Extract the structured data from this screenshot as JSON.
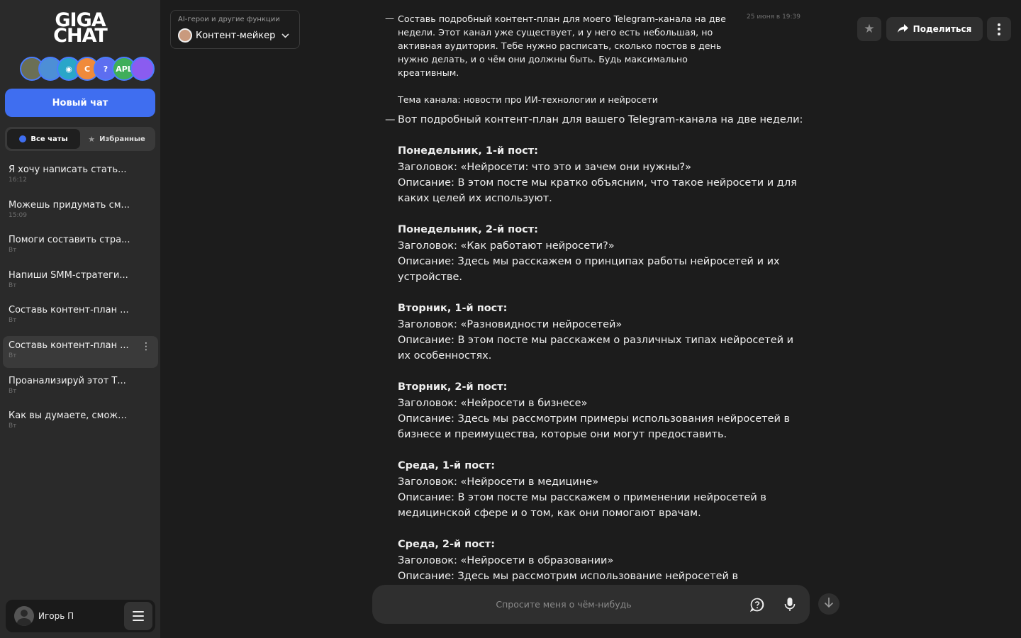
{
  "brand": {
    "line1": "GIGA",
    "line2": "CHAT"
  },
  "hero_avatars": [
    {
      "icon": "cat-avatar",
      "glyph": "",
      "bg": "#6b6f55"
    },
    {
      "icon": "rocket-avatar",
      "glyph": "",
      "bg": "#4d8fd6"
    },
    {
      "icon": "robot-avatar",
      "glyph": "◉",
      "bg": "#2aa6c9"
    },
    {
      "icon": "swirl-avatar",
      "glyph": "C",
      "bg": "#f08a3a"
    },
    {
      "icon": "question-avatar",
      "glyph": "?",
      "bg": "#5d6ef0"
    },
    {
      "icon": "apl-avatar",
      "glyph": "APL",
      "bg": "#3fae5a"
    },
    {
      "icon": "text-avatar",
      "glyph": "",
      "bg": "#8a5cf0"
    }
  ],
  "sidebar": {
    "new_chat": "Новый чат",
    "tabs": {
      "all": "Все чаты",
      "favorites": "Избранные"
    },
    "chats": [
      {
        "title": "Я хочу написать стать...",
        "time": "16:12"
      },
      {
        "title": "Можешь придумать см...",
        "time": "15:09"
      },
      {
        "title": "Помоги составить стра...",
        "time": "Вт"
      },
      {
        "title": "Напиши SMM-стратеги...",
        "time": "Вт"
      },
      {
        "title": "Составь контент-план ...",
        "time": "Вт"
      },
      {
        "title": "Составь контент-план ...",
        "time": "Вт"
      },
      {
        "title": "Проанализируй этот Т...",
        "time": "Вт"
      },
      {
        "title": "Как вы думаете, сможе...",
        "time": "Вт"
      }
    ],
    "user_name": "Игорь П"
  },
  "mode": {
    "caption": "AI-герои и другие функции",
    "label": "Контент-мейкер"
  },
  "header": {
    "share": "Поделиться"
  },
  "user_message": {
    "line1": "Составь подробный контент-план для моего Telegram-канала на две недели. Этот канал уже существует, и у него есть небольшая, но активная аудитория. Тебе нужно расписать, сколько постов в день нужно делать, и о чём они должны быть. Будь максимально креативным.",
    "line2": "Тема канала: новости про ИИ-технологии и нейросети",
    "timestamp": "25 июня в 19:39"
  },
  "bot_message": {
    "intro": "Вот подробный контент-план для вашего Telegram-канала на две недели:",
    "posts": [
      {
        "day": "Понедельник, 1-й пост:",
        "headline": "Заголовок: «Нейросети: что это и зачем они нужны?»",
        "desc": "Описание: В этом посте мы кратко объясним, что такое нейросети и для каких целей их используют."
      },
      {
        "day": "Понедельник, 2-й пост:",
        "headline": "Заголовок: «Как работают нейросети?»",
        "desc": "Описание: Здесь мы расскажем о принципах работы нейросетей и их устройстве."
      },
      {
        "day": "Вторник, 1-й пост:",
        "headline": "Заголовок: «Разновидности нейросетей»",
        "desc": "Описание: В этом посте мы расскажем о различных типах нейросетей и их особенностях."
      },
      {
        "day": "Вторник, 2-й пост:",
        "headline": "Заголовок: «Нейросети в бизнесе»",
        "desc": "Описание: Здесь мы рассмотрим примеры использования нейросетей в бизнесе и преимущества, которые они могут предоставить."
      },
      {
        "day": "Среда, 1-й пост:",
        "headline": "Заголовок: «Нейросети в медицине»",
        "desc": "Описание: В этом посте мы расскажем о применении нейросетей в медицинской сфере и о том, как они помогают врачам."
      },
      {
        "day": "Среда, 2-й пост:",
        "headline": "Заголовок: «Нейросети в образовании»",
        "desc": "Описание: Здесь мы рассмотрим использование нейросетей в"
      }
    ]
  },
  "input": {
    "placeholder": "Спросите меня о чём-нибудь"
  }
}
